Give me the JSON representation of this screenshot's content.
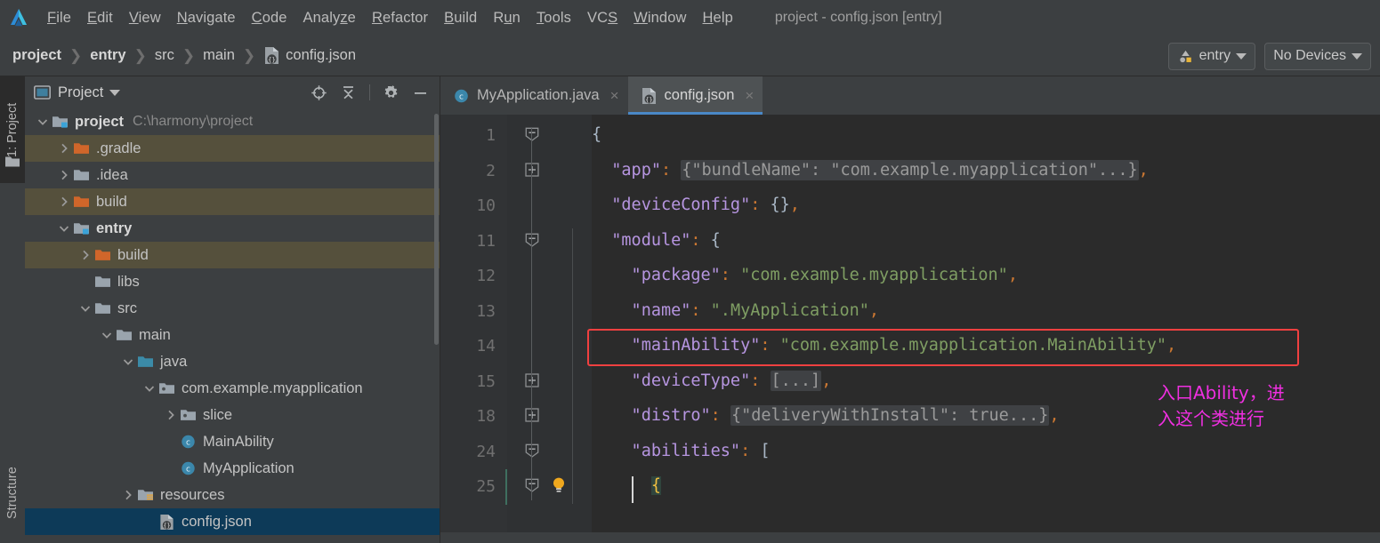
{
  "app": {
    "logo_icon": "deveco-studio-logo",
    "window_title": "project - config.json [entry]"
  },
  "menubar": {
    "items": [
      {
        "label": "File",
        "pre": "",
        "mnemonic": "F",
        "post": "ile"
      },
      {
        "label": "Edit",
        "pre": "",
        "mnemonic": "E",
        "post": "dit"
      },
      {
        "label": "View",
        "pre": "",
        "mnemonic": "V",
        "post": "iew"
      },
      {
        "label": "Navigate",
        "pre": "",
        "mnemonic": "N",
        "post": "avigate"
      },
      {
        "label": "Code",
        "pre": "",
        "mnemonic": "C",
        "post": "ode"
      },
      {
        "label": "Analyze",
        "pre": "Analy",
        "mnemonic": "z",
        "post": "e"
      },
      {
        "label": "Refactor",
        "pre": "",
        "mnemonic": "R",
        "post": "efactor"
      },
      {
        "label": "Build",
        "pre": "",
        "mnemonic": "B",
        "post": "uild"
      },
      {
        "label": "Run",
        "pre": "R",
        "mnemonic": "u",
        "post": "n"
      },
      {
        "label": "Tools",
        "pre": "",
        "mnemonic": "T",
        "post": "ools"
      },
      {
        "label": "VCS",
        "pre": "VC",
        "mnemonic": "S",
        "post": ""
      },
      {
        "label": "Window",
        "pre": "",
        "mnemonic": "W",
        "post": "indow"
      },
      {
        "label": "Help",
        "pre": "",
        "mnemonic": "H",
        "post": "elp"
      }
    ]
  },
  "breadcrumb": {
    "separator": "❯",
    "items": [
      {
        "label": "project",
        "bold": true,
        "icon": ""
      },
      {
        "label": "entry",
        "bold": true,
        "icon": ""
      },
      {
        "label": "src",
        "bold": false,
        "icon": ""
      },
      {
        "label": "main",
        "bold": false,
        "icon": ""
      },
      {
        "label": "config.json",
        "bold": false,
        "icon": "json-file-icon"
      }
    ]
  },
  "navbar_right": {
    "run_config": {
      "label": "entry",
      "icon": "run-config-icon",
      "caret": "chevron-down-icon"
    },
    "device_selector": {
      "label": "No Devices",
      "caret": "chevron-down-icon"
    }
  },
  "left_strip": {
    "tabs": [
      {
        "label": "1: Project",
        "active": true,
        "icon": "folder-icon"
      },
      {
        "label": "Structure",
        "active": false,
        "icon": ""
      }
    ]
  },
  "project_panel": {
    "title": "Project",
    "title_icon": "project-view-icon",
    "caret": "chevron-down-icon",
    "tools": [
      {
        "name": "locate-target-icon",
        "tooltip": "Select Opened File"
      },
      {
        "name": "collapse-all-icon",
        "tooltip": "Collapse All"
      },
      {
        "name": "gear-icon",
        "tooltip": "Settings"
      },
      {
        "name": "minimize-icon",
        "tooltip": "Hide"
      }
    ],
    "tree": [
      {
        "label": "project",
        "path": "C:\\harmony\\project",
        "indent": 0,
        "arrow": "down",
        "icon": "module-folder-icon",
        "bold": true,
        "state": "normal"
      },
      {
        "label": ".gradle",
        "path": "",
        "indent": 1,
        "arrow": "right",
        "icon": "excluded-folder-icon",
        "bold": false,
        "state": "excluded"
      },
      {
        "label": ".idea",
        "path": "",
        "indent": 1,
        "arrow": "right",
        "icon": "folder-icon",
        "bold": false,
        "state": "normal"
      },
      {
        "label": "build",
        "path": "",
        "indent": 1,
        "arrow": "right",
        "icon": "excluded-folder-icon",
        "bold": false,
        "state": "excluded"
      },
      {
        "label": "entry",
        "path": "",
        "indent": 1,
        "arrow": "down",
        "icon": "module-folder-icon",
        "bold": true,
        "state": "normal"
      },
      {
        "label": "build",
        "path": "",
        "indent": 2,
        "arrow": "right",
        "icon": "excluded-folder-icon",
        "bold": false,
        "state": "excluded"
      },
      {
        "label": "libs",
        "path": "",
        "indent": 2,
        "arrow": "none",
        "icon": "folder-icon",
        "bold": false,
        "state": "normal"
      },
      {
        "label": "src",
        "path": "",
        "indent": 2,
        "arrow": "down",
        "icon": "folder-icon",
        "bold": false,
        "state": "normal"
      },
      {
        "label": "main",
        "path": "",
        "indent": 3,
        "arrow": "down",
        "icon": "folder-icon",
        "bold": false,
        "state": "normal"
      },
      {
        "label": "java",
        "path": "",
        "indent": 4,
        "arrow": "down",
        "icon": "source-folder-icon",
        "bold": false,
        "state": "normal"
      },
      {
        "label": "com.example.myapplication",
        "path": "",
        "indent": 5,
        "arrow": "down",
        "icon": "package-icon",
        "bold": false,
        "state": "normal"
      },
      {
        "label": "slice",
        "path": "",
        "indent": 6,
        "arrow": "right",
        "icon": "package-icon",
        "bold": false,
        "state": "normal"
      },
      {
        "label": "MainAbility",
        "path": "",
        "indent": 6,
        "arrow": "none",
        "icon": "java-class-icon",
        "bold": false,
        "state": "normal"
      },
      {
        "label": "MyApplication",
        "path": "",
        "indent": 6,
        "arrow": "none",
        "icon": "java-class-icon",
        "bold": false,
        "state": "normal"
      },
      {
        "label": "resources",
        "path": "",
        "indent": 4,
        "arrow": "right",
        "icon": "resources-folder-icon",
        "bold": false,
        "state": "normal"
      },
      {
        "label": "config.json",
        "path": "",
        "indent": 5,
        "arrow": "none",
        "icon": "json-file-icon",
        "bold": false,
        "state": "selected"
      }
    ]
  },
  "editor": {
    "tabs": [
      {
        "label": "MyApplication.java",
        "icon": "java-class-icon",
        "active": false,
        "close": "×"
      },
      {
        "label": "config.json",
        "icon": "json-file-icon",
        "active": true,
        "close": "×"
      }
    ],
    "lines": [
      {
        "num": "1",
        "fold": "collapse",
        "parts": [
          {
            "t": "{",
            "c": "b"
          }
        ]
      },
      {
        "num": "2",
        "fold": "expand",
        "parts": [
          {
            "t": "  \"app\"",
            "c": "k"
          },
          {
            "t": ": ",
            "c": "c"
          },
          {
            "t": "{\"bundleName\": \"com.example.myapplication\"...}",
            "c": "fold"
          },
          {
            "t": ",",
            "c": "c"
          }
        ]
      },
      {
        "num": "10",
        "fold": "none",
        "parts": [
          {
            "t": "  \"deviceConfig\"",
            "c": "k"
          },
          {
            "t": ": ",
            "c": "c"
          },
          {
            "t": "{}",
            "c": "b"
          },
          {
            "t": ",",
            "c": "c"
          }
        ]
      },
      {
        "num": "11",
        "fold": "collapse",
        "parts": [
          {
            "t": "  \"module\"",
            "c": "k"
          },
          {
            "t": ": ",
            "c": "c"
          },
          {
            "t": "{",
            "c": "b"
          }
        ]
      },
      {
        "num": "12",
        "fold": "none",
        "parts": [
          {
            "t": "    \"package\"",
            "c": "k"
          },
          {
            "t": ": ",
            "c": "c"
          },
          {
            "t": "\"com.example.myapplication\"",
            "c": "s"
          },
          {
            "t": ",",
            "c": "c"
          }
        ]
      },
      {
        "num": "13",
        "fold": "none",
        "parts": [
          {
            "t": "    \"name\"",
            "c": "k"
          },
          {
            "t": ": ",
            "c": "c"
          },
          {
            "t": "\".MyApplication\"",
            "c": "s"
          },
          {
            "t": ",",
            "c": "c"
          }
        ]
      },
      {
        "num": "14",
        "fold": "none",
        "parts": [
          {
            "t": "    \"mainAbility\"",
            "c": "k"
          },
          {
            "t": ": ",
            "c": "c"
          },
          {
            "t": "\"com.example.myapplication.MainAbility\"",
            "c": "s"
          },
          {
            "t": ",",
            "c": "c"
          }
        ]
      },
      {
        "num": "15",
        "fold": "expand",
        "parts": [
          {
            "t": "    \"deviceType\"",
            "c": "k"
          },
          {
            "t": ": ",
            "c": "c"
          },
          {
            "t": "[...]",
            "c": "fold"
          },
          {
            "t": ",",
            "c": "c"
          }
        ]
      },
      {
        "num": "18",
        "fold": "expand",
        "parts": [
          {
            "t": "    \"distro\"",
            "c": "k"
          },
          {
            "t": ": ",
            "c": "c"
          },
          {
            "t": "{\"deliveryWithInstall\": true...}",
            "c": "fold"
          },
          {
            "t": ",",
            "c": "c"
          }
        ]
      },
      {
        "num": "24",
        "fold": "collapse",
        "parts": [
          {
            "t": "    \"abilities\"",
            "c": "k"
          },
          {
            "t": ": ",
            "c": "c"
          },
          {
            "t": "[",
            "c": "b"
          }
        ]
      },
      {
        "num": "25",
        "fold": "collapse",
        "parts": [
          {
            "t": "      ",
            "c": "b"
          }
        ],
        "bulb": true,
        "caret_line": true
      }
    ],
    "line25_brace": "{",
    "bulb_icon": "intention-bulb-icon"
  },
  "annotations": {
    "highlight_box": {
      "name": "main-ability-highlight",
      "color": "#f04040"
    },
    "note": {
      "text": "入口Ability，进\n入这个类进行",
      "color": "#ef2fe0"
    }
  }
}
